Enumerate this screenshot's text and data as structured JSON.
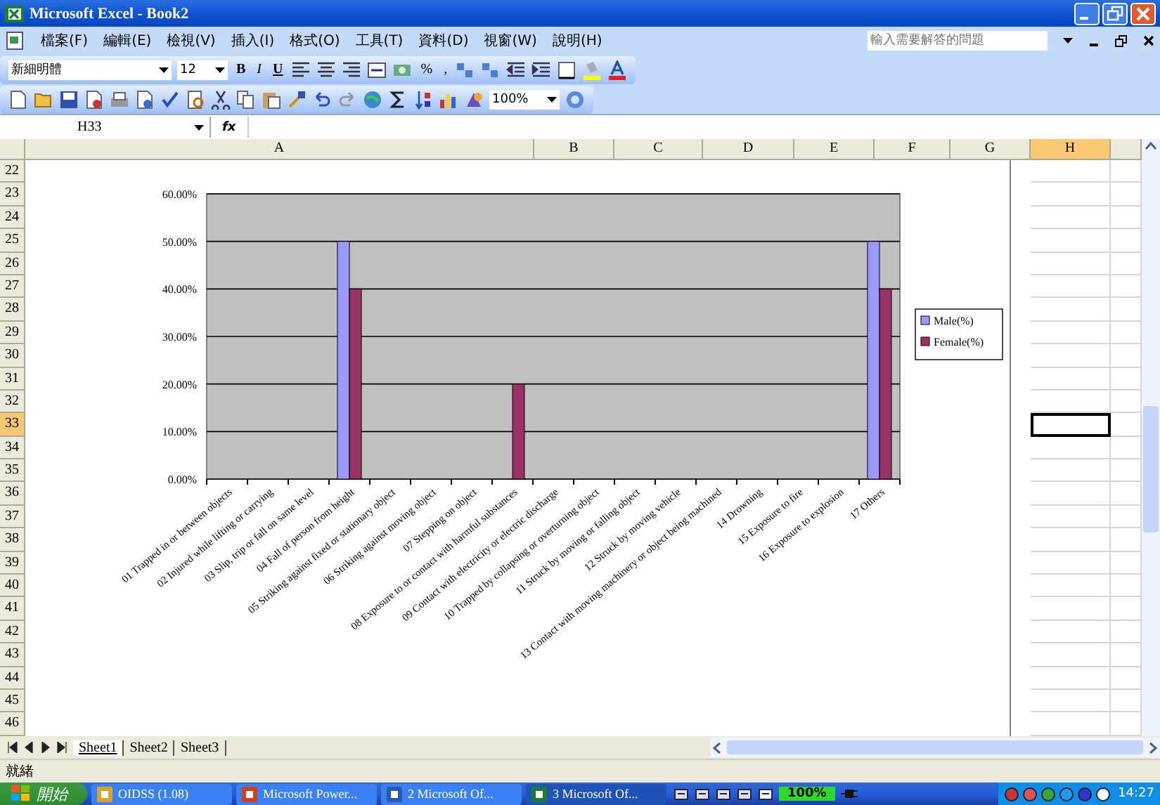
{
  "window": {
    "title": "Microsoft Excel - Book2"
  },
  "menu": [
    "檔案(F)",
    "編輯(E)",
    "檢視(V)",
    "插入(I)",
    "格式(O)",
    "工具(T)",
    "資料(D)",
    "視窗(W)",
    "說明(H)"
  ],
  "help_box": {
    "placeholder": "輸入需要解答的問題"
  },
  "format_toolbar": {
    "font": "新細明體",
    "size": "12",
    "style_buttons": [
      "B",
      "I",
      "U"
    ],
    "percent": "%",
    "comma": ","
  },
  "standard_toolbar": {
    "zoom": "100%"
  },
  "formula_bar": {
    "name_box": "H33",
    "fx": "fx"
  },
  "columns": [
    {
      "label": "A",
      "selected": false
    },
    {
      "label": "B",
      "selected": false
    },
    {
      "label": "C",
      "selected": false
    },
    {
      "label": "D",
      "selected": false
    },
    {
      "label": "E",
      "selected": false
    },
    {
      "label": "F",
      "selected": false
    },
    {
      "label": "G",
      "selected": false
    },
    {
      "label": "H",
      "selected": true
    }
  ],
  "rows": [
    {
      "label": "22",
      "selected": false
    },
    {
      "label": "23",
      "selected": false
    },
    {
      "label": "24",
      "selected": false
    },
    {
      "label": "25",
      "selected": false
    },
    {
      "label": "26",
      "selected": false
    },
    {
      "label": "27",
      "selected": false
    },
    {
      "label": "28",
      "selected": false
    },
    {
      "label": "29",
      "selected": false
    },
    {
      "label": "30",
      "selected": false
    },
    {
      "label": "31",
      "selected": false
    },
    {
      "label": "32",
      "selected": false
    },
    {
      "label": "33",
      "selected": true
    },
    {
      "label": "34",
      "selected": false
    },
    {
      "label": "35",
      "selected": false
    },
    {
      "label": "36",
      "selected": false
    },
    {
      "label": "37",
      "selected": false
    },
    {
      "label": "38",
      "selected": false
    },
    {
      "label": "39",
      "selected": false
    },
    {
      "label": "40",
      "selected": false
    },
    {
      "label": "41",
      "selected": false
    },
    {
      "label": "42",
      "selected": false
    },
    {
      "label": "43",
      "selected": false
    },
    {
      "label": "44",
      "selected": false
    },
    {
      "label": "45",
      "selected": false
    },
    {
      "label": "46",
      "selected": false
    }
  ],
  "chart": {
    "chart_data": {
      "type": "bar",
      "categories": [
        "01 Trapped in or between objects",
        "02 Injured while lifting or carrying",
        "03 Slip, trip or fall on same level",
        "04 Fall of person from height",
        "05 Striking against fixed or stationary object",
        "06 Striking against moving object",
        "07 Stepping on object",
        "08 Exposure to or contact with harmful substances",
        "09 Contact with electricity or electric discharge",
        "10 Trapped by collapsing or overturning object",
        "11 Struck by moving or falling object",
        "12 Struck by moving vehicle",
        "13 Contact with moving machinery or object being machined",
        "14 Drowning",
        "15 Exposure to fire",
        "16 Exposure to explosion",
        "17 Others"
      ],
      "series": [
        {
          "name": "Male(%)",
          "color": "#9999ff",
          "values": [
            0,
            0,
            0,
            0.5,
            0,
            0,
            0,
            0,
            0,
            0,
            0,
            0,
            0,
            0,
            0,
            0,
            0.5
          ]
        },
        {
          "name": "Female(%)",
          "color": "#993366",
          "values": [
            0,
            0,
            0,
            0.4,
            0,
            0,
            0,
            0.2,
            0,
            0,
            0,
            0,
            0,
            0,
            0,
            0,
            0.4
          ]
        }
      ],
      "ylim": [
        0,
        0.6
      ],
      "grid": true,
      "legend": true,
      "yticks": [
        {
          "value": 0,
          "label": "0.00%"
        },
        {
          "value": 0.1,
          "label": "10.00%"
        },
        {
          "value": 0.2,
          "label": "20.00%"
        },
        {
          "value": 0.3,
          "label": "30.00%"
        },
        {
          "value": 0.4,
          "label": "40.00%"
        },
        {
          "value": 0.5,
          "label": "50.00%"
        },
        {
          "value": 0.6,
          "label": "60.00%"
        }
      ]
    }
  },
  "sheet_tabs": [
    {
      "label": "Sheet1",
      "selected": true
    },
    {
      "label": "Sheet2",
      "selected": false
    },
    {
      "label": "Sheet3",
      "selected": false
    }
  ],
  "status_bar": {
    "text": "就緒"
  },
  "taskbar": {
    "start": "開始",
    "items": [
      {
        "label": "OIDSS (1.08)",
        "selected": false
      },
      {
        "label": "Microsoft Power...",
        "selected": false
      },
      {
        "label": "2 Microsoft Of...",
        "selected": false
      },
      {
        "label": "3 Microsoft Of...",
        "selected": true
      }
    ],
    "battery": "100%",
    "clock": "14:27"
  }
}
